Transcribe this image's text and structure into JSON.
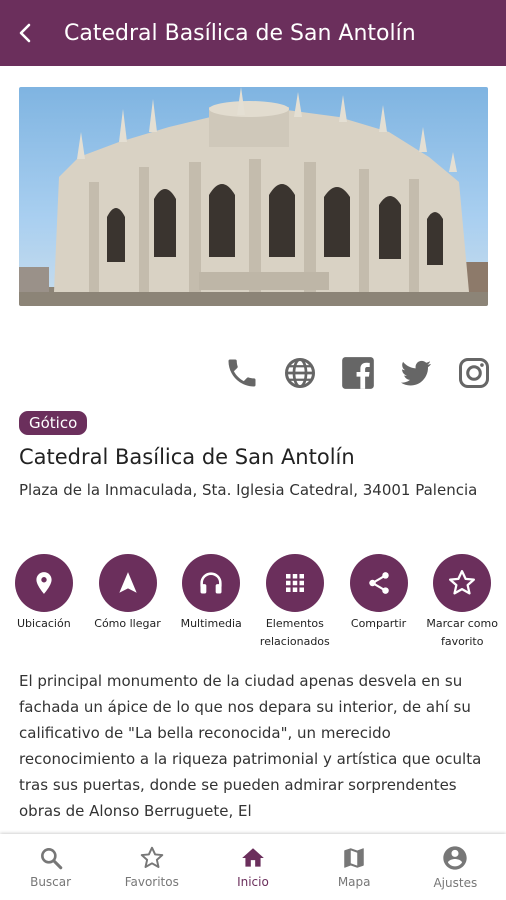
{
  "appbar": {
    "title": "Catedral Basílica de San  Antolín"
  },
  "place": {
    "tag": "Gótico",
    "name": "Catedral Basílica de San  Antolín",
    "address": "Plaza de la Inmaculada, Sta. Iglesia Catedral, 34001 Palencia"
  },
  "social": [
    "phone-icon",
    "globe-icon",
    "facebook-icon",
    "twitter-icon",
    "instagram-icon"
  ],
  "actions": [
    {
      "label": "Ubicación",
      "icon": "location-pin-icon"
    },
    {
      "label": "Cómo llegar",
      "icon": "navigation-arrow-icon"
    },
    {
      "label": "Multimedia",
      "icon": "headphones-icon"
    },
    {
      "label": "Elementos relacionados",
      "icon": "grid-icon"
    },
    {
      "label": "Compartir",
      "icon": "share-icon"
    },
    {
      "label": "Marcar como favorito",
      "icon": "star-outline-icon"
    }
  ],
  "description": "El principal monumento de la ciudad apenas desvela en su fachada un ápice de lo que nos depara su interior, de ahí su calificativo de \"La bella reconocida\", un merecido reconocimiento a la riqueza patrimonial y artística que oculta tras sus puertas, donde se pueden admirar sorprendentes obras de Alonso Berruguete, El",
  "nav": [
    {
      "label": "Buscar",
      "icon": "search-icon"
    },
    {
      "label": "Favoritos",
      "icon": "star-icon"
    },
    {
      "label": "Inicio",
      "icon": "home-icon",
      "active": true
    },
    {
      "label": "Mapa",
      "icon": "map-icon"
    },
    {
      "label": "Ajustes",
      "icon": "account-icon"
    }
  ],
  "colors": {
    "primary": "#6b2f5c",
    "icon_gray": "#666666",
    "nav_inactive": "#777777"
  }
}
